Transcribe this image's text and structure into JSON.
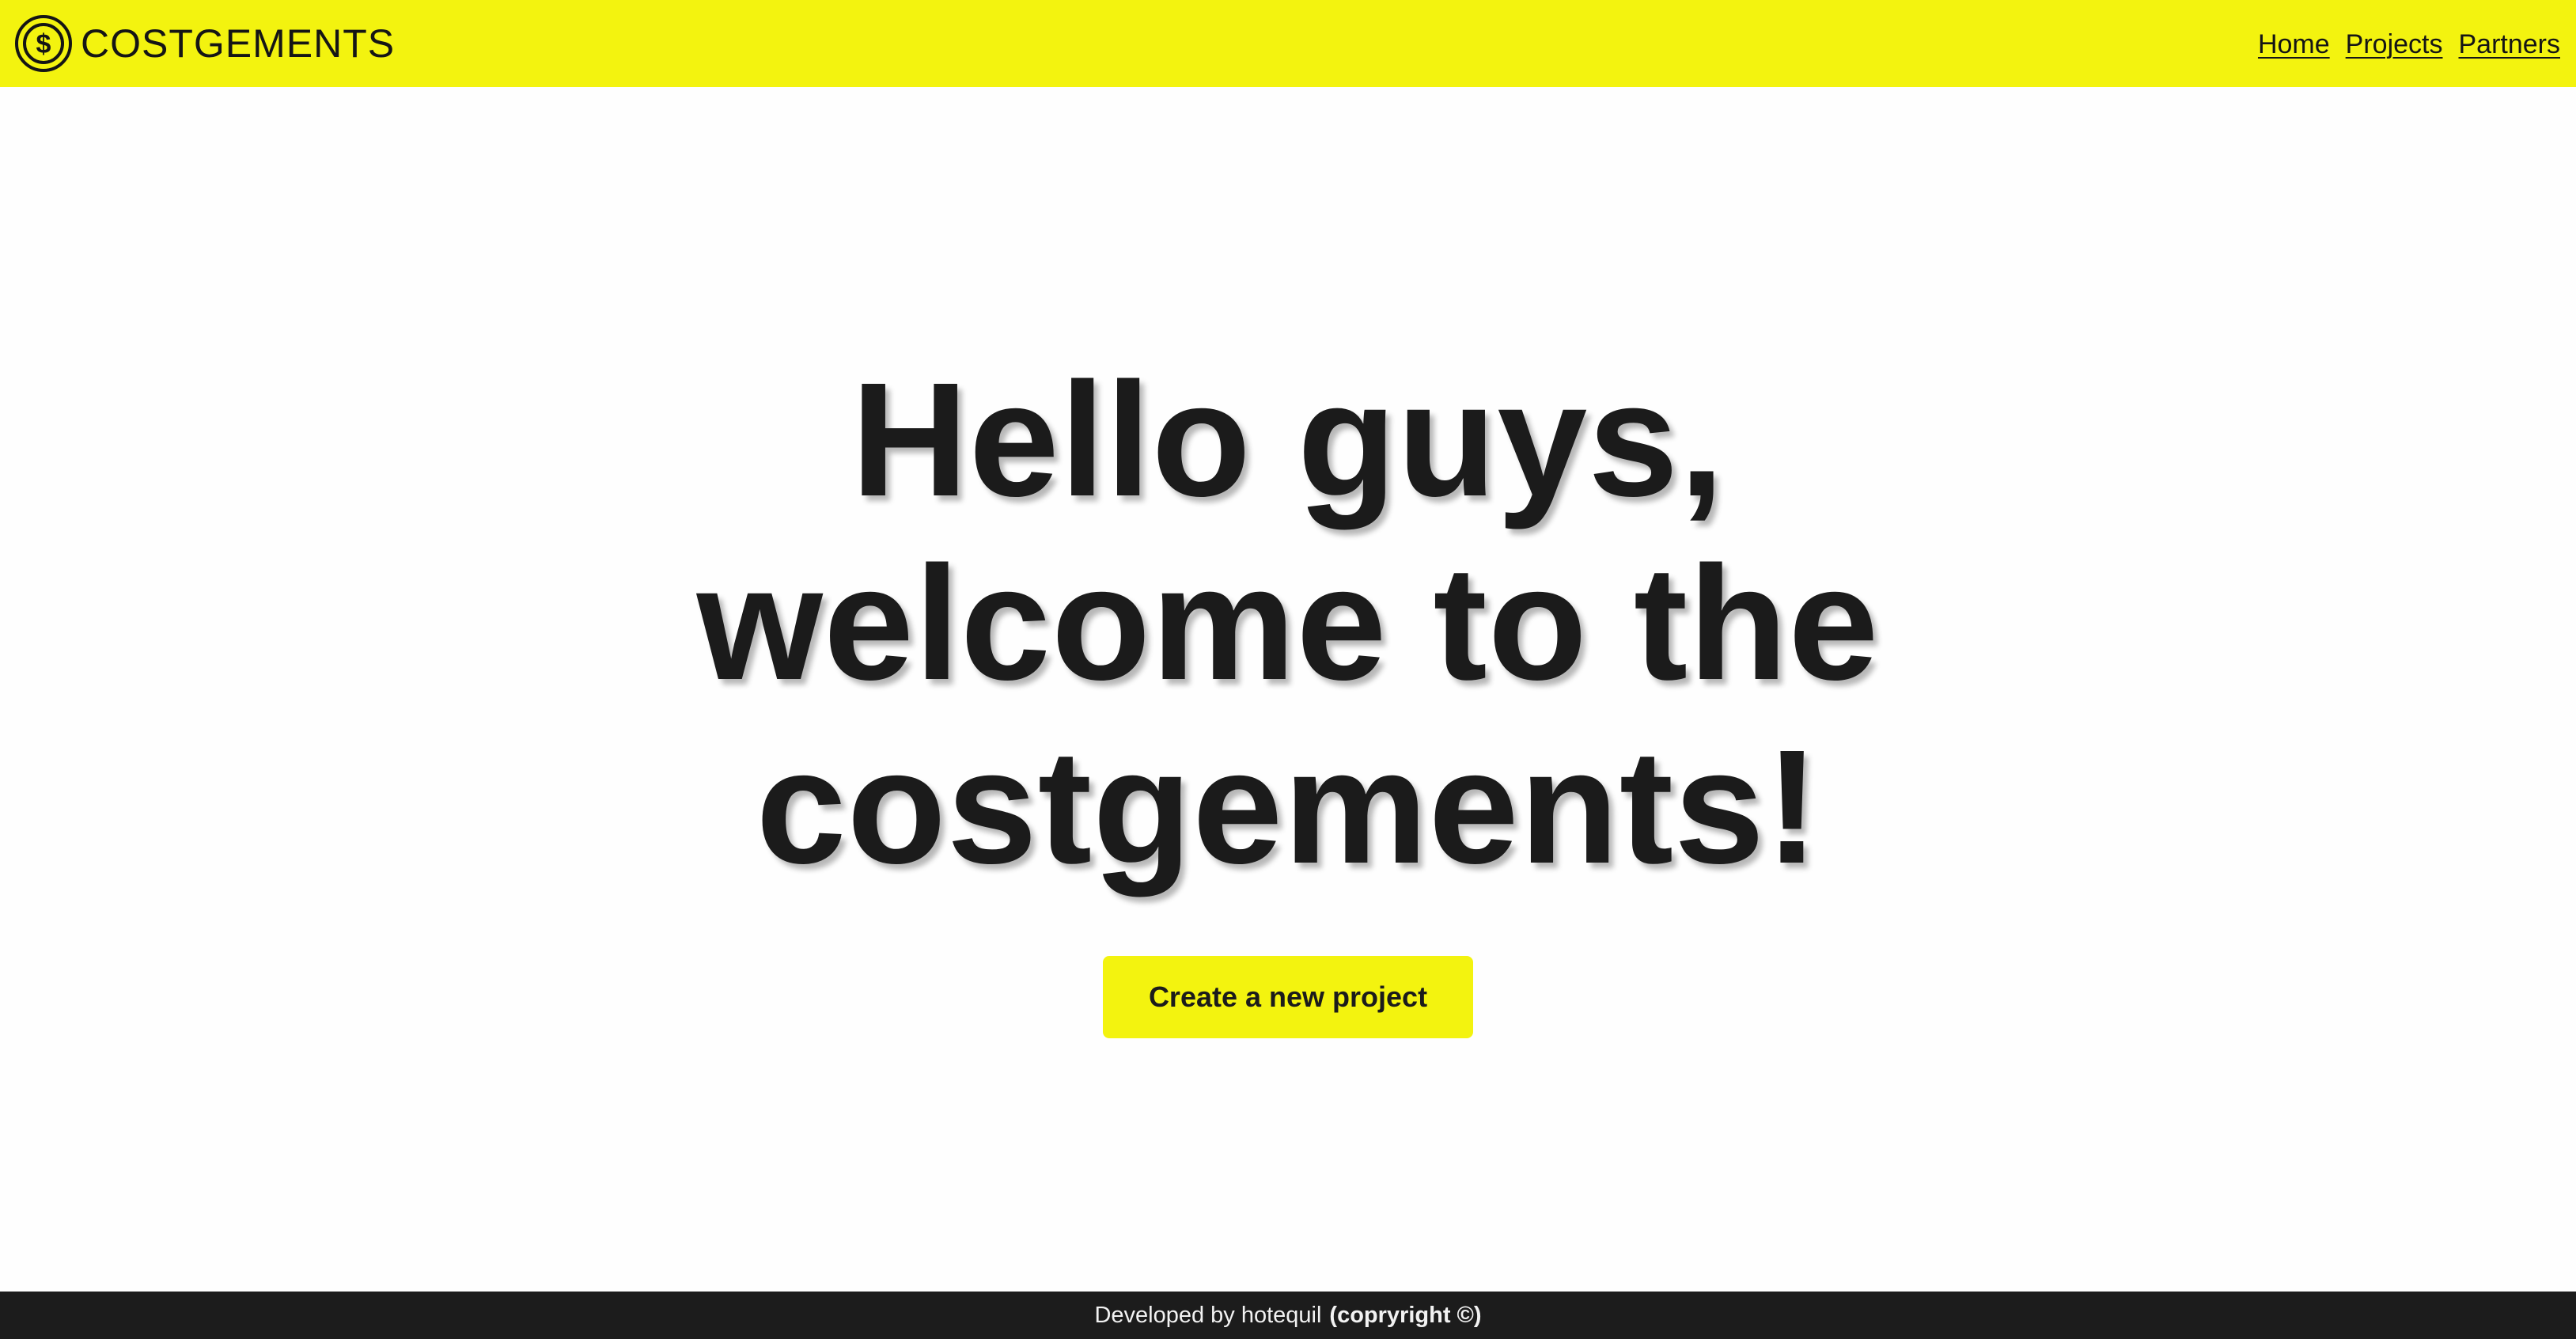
{
  "header": {
    "brand_name": "COSTGEMENTS",
    "brand_icon": "dollar-coin-icon",
    "nav": {
      "home": "Home",
      "projects": "Projects",
      "partners": "Partners"
    }
  },
  "hero": {
    "title": "Hello guys, welcome to the costgements!",
    "cta_label": "Create a new project"
  },
  "footer": {
    "developed_by": "Developed by hotequil",
    "copyright": "(copryright ©)"
  },
  "colors": {
    "accent": "#f3f30f",
    "text": "#1b1b1b",
    "footer_bg": "#1c1c1c",
    "page_bg": "#fefefe"
  }
}
